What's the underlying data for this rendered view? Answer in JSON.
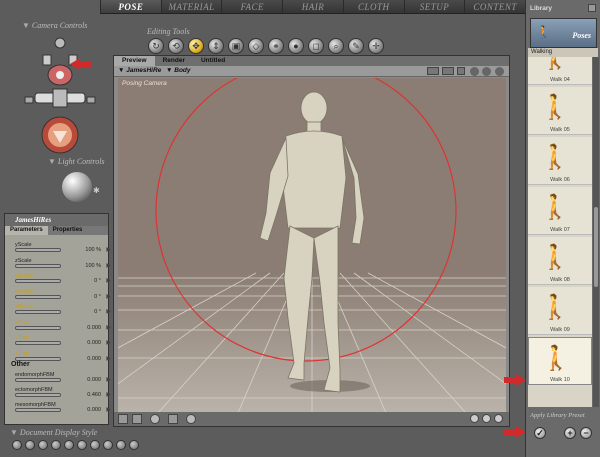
{
  "tabs": [
    "POSE",
    "MATERIAL",
    "FACE",
    "HAIR",
    "CLOTH",
    "SETUP",
    "CONTENT"
  ],
  "active_tab": "POSE",
  "left": {
    "camera_controls_label": "Camera Controls",
    "light_controls_label": "Light Controls",
    "document_display_label": "Document Display Style"
  },
  "editing_tools_label": "Editing Tools",
  "document": {
    "tabs": [
      "Preview",
      "Render",
      "Untitled"
    ],
    "active_tab": "Preview",
    "figure_menu": "JamesHiRe",
    "actor_menu": "Body",
    "camera_label": "Posing Camera"
  },
  "params": {
    "title": "JamesHiRes",
    "tabs": [
      "Parameters",
      "Properties"
    ],
    "active_tab": "Parameters",
    "rows": [
      {
        "name": "yScale",
        "value": "100 %",
        "highlight": false
      },
      {
        "name": "zScale",
        "value": "100 %",
        "highlight": false
      },
      {
        "name": "yRotate",
        "value": "0 °",
        "highlight": true
      },
      {
        "name": "xRotate",
        "value": "0 °",
        "highlight": true
      },
      {
        "name": "zRotate",
        "value": "0 °",
        "highlight": true
      },
      {
        "name": "xTran",
        "value": "0.000",
        "highlight": true
      },
      {
        "name": "yTran",
        "value": "0.000",
        "highlight": true
      },
      {
        "name": "zTran",
        "value": "0.000",
        "highlight": true
      }
    ],
    "other_label": "Other",
    "other_rows": [
      {
        "name": "endomorphFBM",
        "value": "0.000"
      },
      {
        "name": "ectomorphFBM",
        "value": "0.460"
      },
      {
        "name": "mesomorphFBM",
        "value": "0.000"
      }
    ]
  },
  "library": {
    "title": "Library",
    "header_label": "Poses",
    "category": "Walking",
    "items": [
      "Walk 04",
      "Walk 05",
      "Walk 06",
      "Walk 07",
      "Walk 08",
      "Walk 09",
      "Walk 10"
    ],
    "selected": "Walk 10",
    "apply_label": "Apply Library Preset"
  },
  "colors": {
    "accent": "#d12a2a",
    "highlight_param": "#c8a020",
    "viewport_bg": "#8b7d73",
    "trackball": "#d33"
  }
}
